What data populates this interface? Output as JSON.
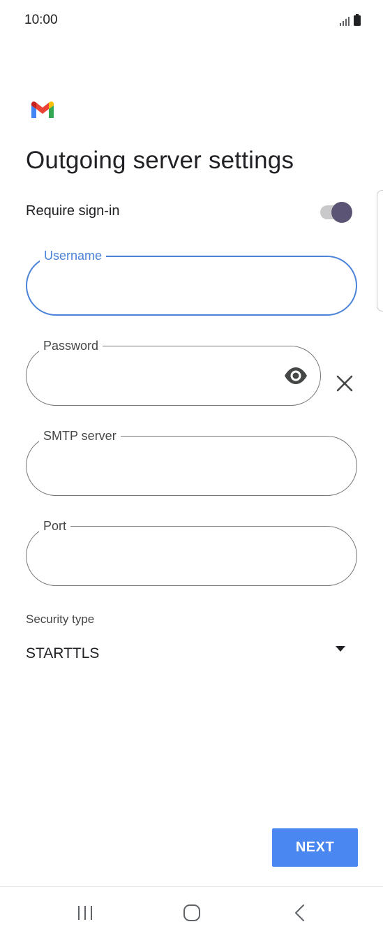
{
  "status_bar": {
    "time": "10:00",
    "icons": [
      "signal-icon",
      "battery-icon"
    ]
  },
  "app": {
    "logo": "gmail-logo"
  },
  "page": {
    "title": "Outgoing server settings"
  },
  "require_signin": {
    "label": "Require sign-in",
    "enabled": true
  },
  "fields": {
    "username": {
      "label": "Username",
      "value": "",
      "focused": true
    },
    "password": {
      "label": "Password",
      "value": ""
    },
    "smtp_server": {
      "label": "SMTP server",
      "value": ""
    },
    "port": {
      "label": "Port",
      "value": ""
    }
  },
  "security": {
    "label": "Security type",
    "selected": "STARTTLS"
  },
  "actions": {
    "next_label": "NEXT"
  },
  "nav": [
    "recent-apps-icon",
    "home-icon",
    "back-icon"
  ],
  "colors": {
    "accent": "#4a83d8",
    "button": "#4a87f0",
    "toggle_thumb": "#5b5474",
    "text": "#202124"
  }
}
